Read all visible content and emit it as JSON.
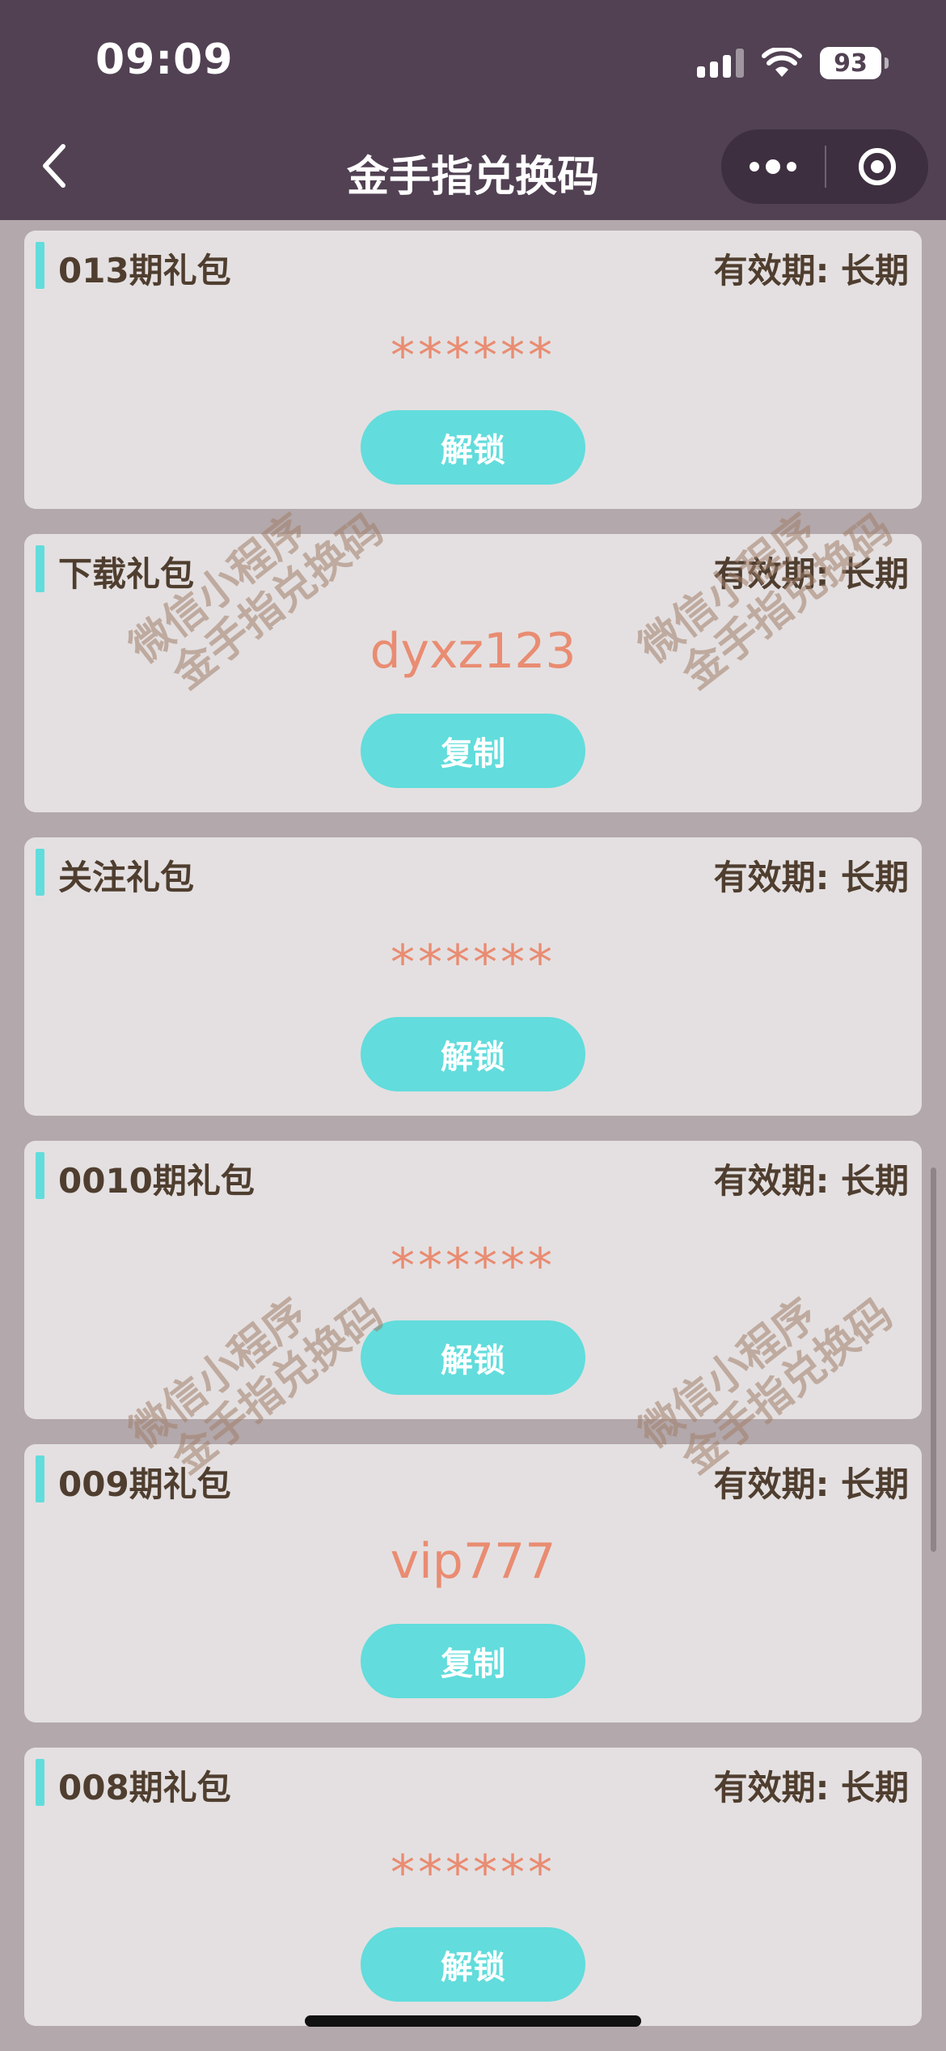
{
  "status_bar": {
    "time": "09:09",
    "battery": "93"
  },
  "nav": {
    "title": "金手指兑换码",
    "back_icon": "chevron-left-icon",
    "more_icon": "more-dots-icon",
    "close_icon": "target-close-icon"
  },
  "watermark": {
    "line1": "微信小程序",
    "line2": "金手指兑换码"
  },
  "gifts": [
    {
      "title": "013期礼包",
      "validity": "有效期: 长期",
      "code": "******",
      "button": "解锁",
      "masked": true
    },
    {
      "title": "下载礼包",
      "validity": "有效期: 长期",
      "code": "dyxz123",
      "button": "复制",
      "masked": false
    },
    {
      "title": "关注礼包",
      "validity": "有效期: 长期",
      "code": "******",
      "button": "解锁",
      "masked": true
    },
    {
      "title": "0010期礼包",
      "validity": "有效期: 长期",
      "code": "******",
      "button": "解锁",
      "masked": true
    },
    {
      "title": "009期礼包",
      "validity": "有效期: 长期",
      "code": "vip777",
      "button": "复制",
      "masked": false
    },
    {
      "title": "008期礼包",
      "validity": "有效期: 长期",
      "code": "******",
      "button": "解锁",
      "masked": true
    }
  ],
  "colors": {
    "header_bg": "#514153",
    "page_bg": "#b3a8ab",
    "card_bg": "#e4e0e1",
    "accent": "#62dcdc",
    "code_text": "#e98c72",
    "title_text": "#4f3e2f"
  }
}
